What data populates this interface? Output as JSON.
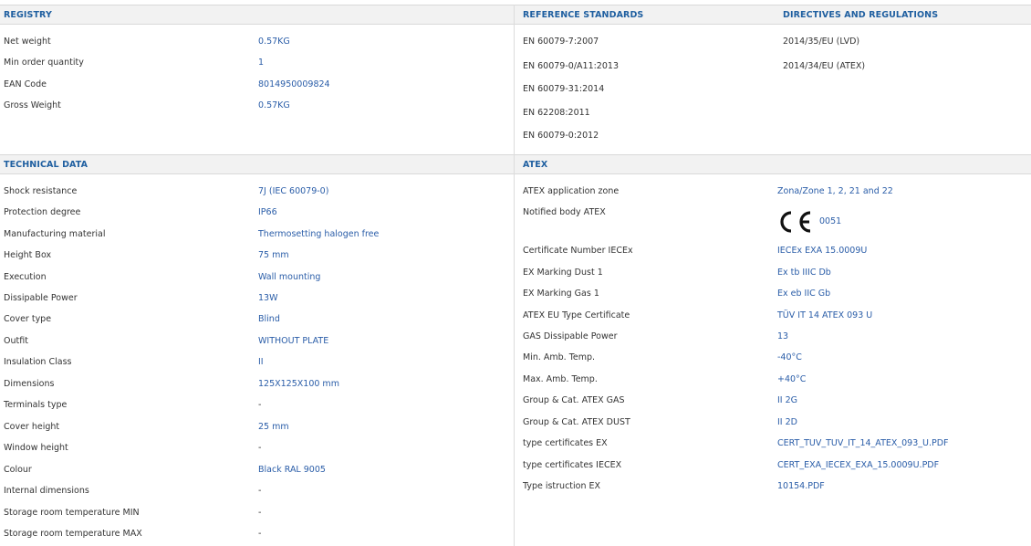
{
  "registry": {
    "header": "REGISTRY",
    "rows": [
      {
        "label": "Net weight",
        "value": "0.57KG"
      },
      {
        "label": "Min order quantity",
        "value": "1"
      },
      {
        "label": "EAN Code",
        "value": "8014950009824"
      },
      {
        "label": "Gross Weight",
        "value": "0.57KG"
      }
    ]
  },
  "reference_standards": {
    "header": "REFERENCE STANDARDS",
    "items": [
      "EN 60079-7:2007",
      "EN 60079-0/A11:2013",
      "EN 60079-31:2014",
      "EN 62208:2011",
      "EN 60079-0:2012"
    ]
  },
  "directives": {
    "header": "DIRECTIVES AND REGULATIONS",
    "items": [
      "2014/35/EU (LVD)",
      "2014/34/EU (ATEX)"
    ]
  },
  "technical": {
    "header": "TECHNICAL DATA",
    "rows": [
      {
        "label": "Shock resistance",
        "value": "7J (IEC 60079-0)"
      },
      {
        "label": "Protection degree",
        "value": "IP66"
      },
      {
        "label": "Manufacturing material",
        "value": "Thermosetting halogen free"
      },
      {
        "label": "Height Box",
        "value": "75 mm"
      },
      {
        "label": "Execution",
        "value": "Wall mounting"
      },
      {
        "label": "Dissipable Power",
        "value": "13W"
      },
      {
        "label": "Cover type",
        "value": "Blind"
      },
      {
        "label": "Outfit",
        "value": "WITHOUT PLATE"
      },
      {
        "label": "Insulation Class",
        "value": "II"
      },
      {
        "label": "Dimensions",
        "value": "125X125X100 mm"
      },
      {
        "label": "Terminals type",
        "value": "-"
      },
      {
        "label": "Cover height",
        "value": "25 mm"
      },
      {
        "label": "Window height",
        "value": "-"
      },
      {
        "label": "Colour",
        "value": "Black RAL 9005"
      },
      {
        "label": "Internal dimensions",
        "value": "-"
      },
      {
        "label": "Storage room temperature MIN",
        "value": "-"
      },
      {
        "label": "Storage room temperature MAX",
        "value": "-"
      }
    ]
  },
  "atex": {
    "header": "ATEX",
    "application_zone": {
      "label": "ATEX application zone",
      "value": "Zona/Zone 1, 2, 21 and 22"
    },
    "notified_body": {
      "label": "Notified body ATEX",
      "ce_symbol": "CE",
      "number": "0051"
    },
    "rows": [
      {
        "label": "Certificate Number IECEx",
        "value": "IECEx EXA 15.0009U"
      },
      {
        "label": "EX Marking Dust 1",
        "value": "Ex tb IIIC Db"
      },
      {
        "label": "EX Marking Gas 1",
        "value": "Ex eb IIC Gb"
      },
      {
        "label": "ATEX EU Type Certificate",
        "value": "TÜV IT 14 ATEX 093 U"
      },
      {
        "label": "GAS Dissipable Power",
        "value": "13"
      },
      {
        "label": "Min. Amb. Temp.",
        "value": "-40°C"
      },
      {
        "label": "Max. Amb. Temp.",
        "value": "+40°C"
      },
      {
        "label": "Group & Cat. ATEX GAS",
        "value": "II 2G"
      },
      {
        "label": "Group & Cat. ATEX DUST",
        "value": "II 2D"
      }
    ],
    "docs": [
      {
        "label": "type certificates EX",
        "value": "CERT_TUV_TUV_IT_14_ATEX_093_U.PDF"
      },
      {
        "label": "type certificates IECEX",
        "value": "CERT_EXA_IECEX_EXA_15.0009U.PDF"
      },
      {
        "label": "Type istruction EX",
        "value": "10154.PDF"
      }
    ]
  },
  "colors": {
    "header_text": "#1f5fa0",
    "value_text": "#2a5da8",
    "header_bg": "#f2f2f2",
    "border": "#d9d9d9"
  }
}
